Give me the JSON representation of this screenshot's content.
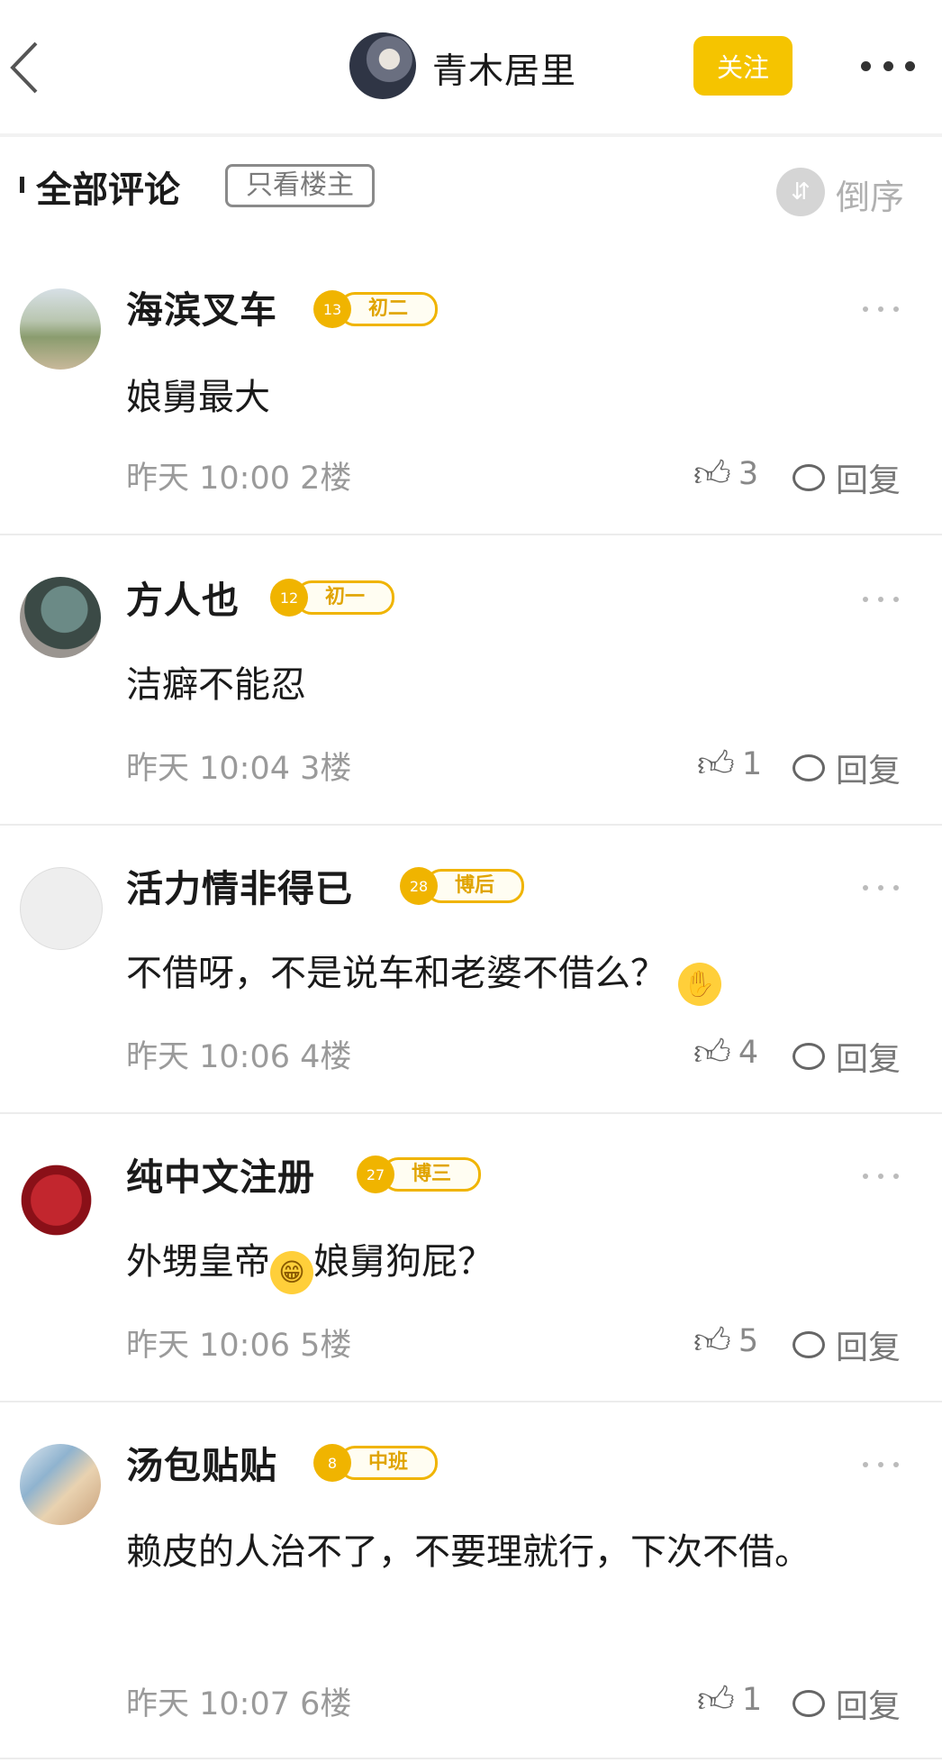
{
  "header": {
    "back_icon": "chevron-left-icon",
    "username": "青木居里",
    "follow_label": "关注",
    "more_icon": "more-horizontal-icon"
  },
  "section": {
    "title": "全部评论",
    "filter_label": "只看楼主",
    "sort_label": "倒序",
    "sort_icon": "sort-icon"
  },
  "comments": [
    {
      "name": "海滨叉车",
      "level_num": "13",
      "level": "初二",
      "text": "娘舅最大",
      "time": "昨天 10:00",
      "floor": "2楼",
      "likes": "3",
      "reply": "回复"
    },
    {
      "name": "方人也",
      "level_num": "12",
      "level": "初一",
      "text": "洁癖不能忍",
      "time": "昨天 10:04",
      "floor": "3楼",
      "likes": "1",
      "reply": "回复"
    },
    {
      "name": "活力情非得已",
      "level_num": "28",
      "level": "博后",
      "text": "不借呀，不是说车和老婆不借么？",
      "time": "昨天 10:06",
      "floor": "4楼",
      "likes": "4",
      "reply": "回复"
    },
    {
      "name": "纯中文注册",
      "level_num": "27",
      "level": "博三",
      "text_a": "外甥皇帝",
      "text_b": "娘舅狗屁？",
      "time": "昨天 10:06",
      "floor": "5楼",
      "likes": "5",
      "reply": "回复"
    },
    {
      "name": "汤包贴贴",
      "level_num": "8",
      "level": "中班",
      "text": "赖皮的人治不了，不要理就行，下次不借。",
      "time": "昨天 10:07",
      "floor": "6楼",
      "likes": "1",
      "reply": "回复"
    }
  ],
  "colors": {
    "accent": "#f5c400",
    "badge": "#f0b400",
    "meta_text": "#9a9a9a"
  }
}
